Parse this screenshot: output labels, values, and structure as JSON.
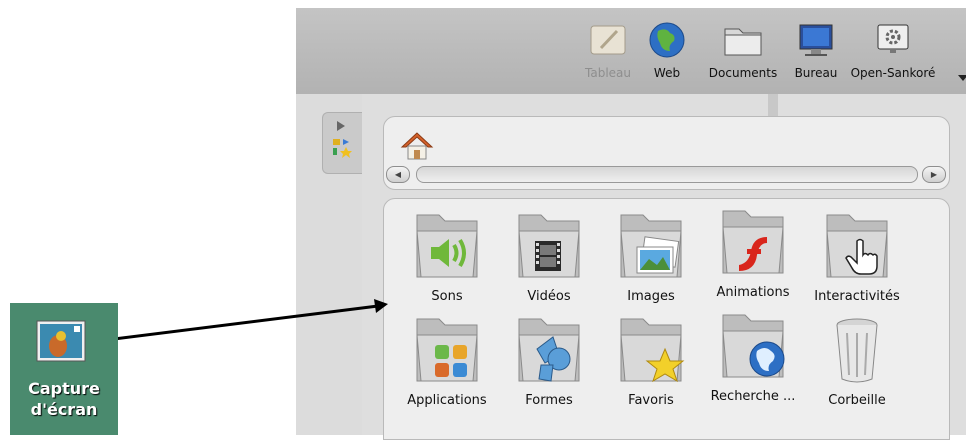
{
  "toolbar": {
    "buttons": [
      {
        "label": "Tableau",
        "icon": "tableau-icon",
        "enabled": false
      },
      {
        "label": "Web",
        "icon": "globe-icon",
        "enabled": true
      },
      {
        "label": "Documents",
        "icon": "documents-folder-icon",
        "enabled": true
      },
      {
        "label": "Bureau",
        "icon": "desktop-monitor-icon",
        "enabled": true
      },
      {
        "label": "Open-Sankoré",
        "icon": "settings-gear-icon",
        "enabled": true
      }
    ]
  },
  "library": {
    "items": [
      {
        "label": "Sons",
        "icon": "sound-folder-icon"
      },
      {
        "label": "Vidéos",
        "icon": "video-folder-icon"
      },
      {
        "label": "Images",
        "icon": "images-folder-icon"
      },
      {
        "label": "Animations",
        "icon": "flash-folder-icon"
      },
      {
        "label": "Interactivités",
        "icon": "hand-pointer-folder-icon"
      },
      {
        "label": "Applications",
        "icon": "applications-folder-icon"
      },
      {
        "label": "Formes",
        "icon": "shapes-folder-icon"
      },
      {
        "label": "Favoris",
        "icon": "star-folder-icon"
      },
      {
        "label": "Recherche ...",
        "icon": "web-search-folder-icon"
      },
      {
        "label": "Corbeille",
        "icon": "trash-icon"
      }
    ]
  },
  "desktop_icon": {
    "line1": "Capture",
    "line2": "d'écran"
  },
  "colors": {
    "toolbar_bg": "#b8b8b8",
    "panel_bg": "#dedede",
    "desktop_bg": "#4a8a6e",
    "flash_red": "#d9261c",
    "folder_gray": "#c9c9c9"
  }
}
